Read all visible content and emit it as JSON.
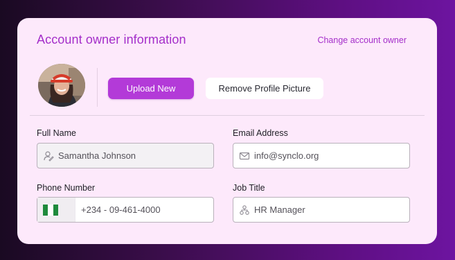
{
  "header": {
    "title": "Account owner information",
    "change_owner_link": "Change account owner"
  },
  "profile": {
    "upload_label": "Upload New",
    "remove_label": "Remove Profile Picture"
  },
  "form": {
    "full_name": {
      "label": "Full Name",
      "value": "Samantha Johnson"
    },
    "email": {
      "label": "Email Address",
      "value": "info@synclo.org"
    },
    "phone": {
      "label": "Phone Number",
      "value": "+234 - 09-461-4000",
      "country_flag": "nigeria-flag"
    },
    "job_title": {
      "label": "Job Title",
      "value": "HR Manager"
    }
  },
  "colors": {
    "accent": "#a42ec9",
    "button_primary": "#b33ad8",
    "card_bg": "#fde9fb"
  }
}
